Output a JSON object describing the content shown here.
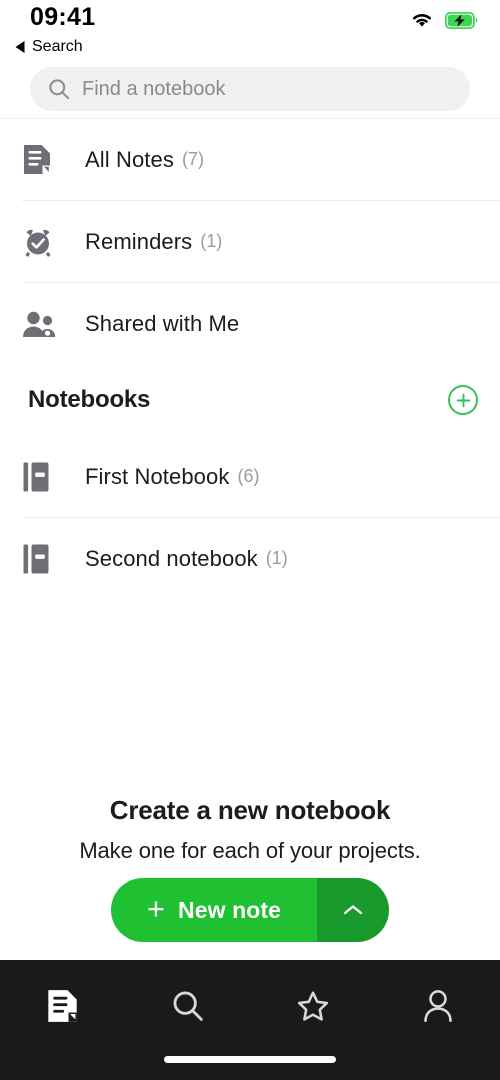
{
  "status_bar": {
    "time": "09:41",
    "wifi_icon": "wifi-icon",
    "battery_icon": "battery-charging-icon",
    "battery_color": "#3cd756"
  },
  "nav": {
    "back_icon": "back-caret-icon",
    "back_label": "Search"
  },
  "search": {
    "icon": "search-icon",
    "value": "",
    "placeholder": "Find a notebook"
  },
  "main_list": [
    {
      "label": "All Notes",
      "count": "(7)",
      "icon": "notes-document-icon"
    },
    {
      "label": "Reminders",
      "count": "(1)",
      "icon": "alarm-clock-check-icon"
    },
    {
      "label": "Shared with Me",
      "count": "",
      "icon": "people-shared-icon"
    }
  ],
  "notebooks_section": {
    "title": "Notebooks",
    "add_icon": "plus-circle-icon",
    "add_color": "#34c05a",
    "items": [
      {
        "label": "First Notebook",
        "count": "(6)",
        "icon": "notebook-icon"
      },
      {
        "label": "Second notebook",
        "count": "(1)",
        "icon": "notebook-icon"
      }
    ]
  },
  "cta": {
    "title": "Create a new notebook",
    "subtitle": "Make one for each of your projects.",
    "button_label": "New note",
    "button_plus_icon": "plus-icon",
    "button_chevron_icon": "chevron-up-icon",
    "button_color": "#20c033",
    "button_chevron_color": "#199a2c"
  },
  "tab_bar": {
    "background": "#1a1a1a",
    "tabs": [
      {
        "name": "notes",
        "icon": "notes-document-icon",
        "active": true
      },
      {
        "name": "search",
        "icon": "search-icon",
        "active": false
      },
      {
        "name": "shortcuts",
        "icon": "star-icon",
        "active": false
      },
      {
        "name": "account",
        "icon": "person-icon",
        "active": false
      }
    ]
  }
}
